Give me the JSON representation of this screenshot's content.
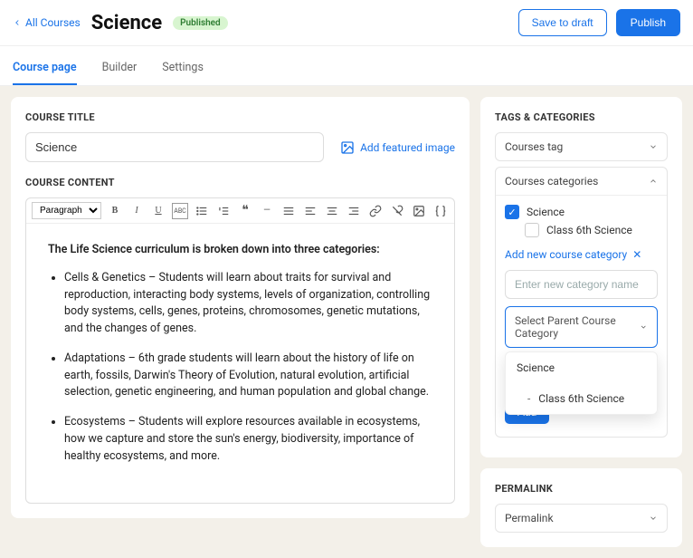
{
  "header": {
    "back_label": "All Courses",
    "title": "Science",
    "status": "Published",
    "save_draft": "Save to draft",
    "publish": "Publish"
  },
  "tabs": [
    {
      "label": "Course page",
      "active": true
    },
    {
      "label": "Builder",
      "active": false
    },
    {
      "label": "Settings",
      "active": false
    }
  ],
  "main": {
    "title_label": "COURSE TITLE",
    "title_value": "Science",
    "featured_label": "Add featured image",
    "content_label": "COURSE CONTENT",
    "format_select": "Paragraph",
    "lead": "The Life Science curriculum is broken down into three categories",
    "bullets": [
      "Cells & Genetics – Students will learn about traits for survival and reproduction, interacting body systems, levels of organization, controlling body systems, cells, genes, proteins, chromosomes, genetic mutations, and the changes of genes.",
      "Adaptations – 6th grade students will learn about the history of life on earth, fossils, Darwin's Theory of Evolution, natural evolution, artificial selection, genetic engineering, and human population and global change.",
      "Ecosystems – Students will explore resources available in ecosystems, how we capture and store the sun's energy, biodiversity, importance of healthy ecosystems, and more."
    ]
  },
  "side": {
    "tags_label": "TAGS & CATEGORIES",
    "tag_panel": "Courses tag",
    "cat_panel": "Courses categories",
    "categories": [
      {
        "label": "Science",
        "checked": true
      },
      {
        "label": "Class 6th Science",
        "checked": false,
        "sub": true
      }
    ],
    "add_new_label": "Add new course category",
    "new_cat_placeholder": "Enter new category name",
    "parent_select": "Select Parent Course Category",
    "dropdown": [
      {
        "label": "Science"
      },
      {
        "label": "Class 6th Science",
        "sub": true
      }
    ],
    "add_btn": "Add",
    "permalink_label": "PERMALINK",
    "permalink_value": "Permalink"
  }
}
